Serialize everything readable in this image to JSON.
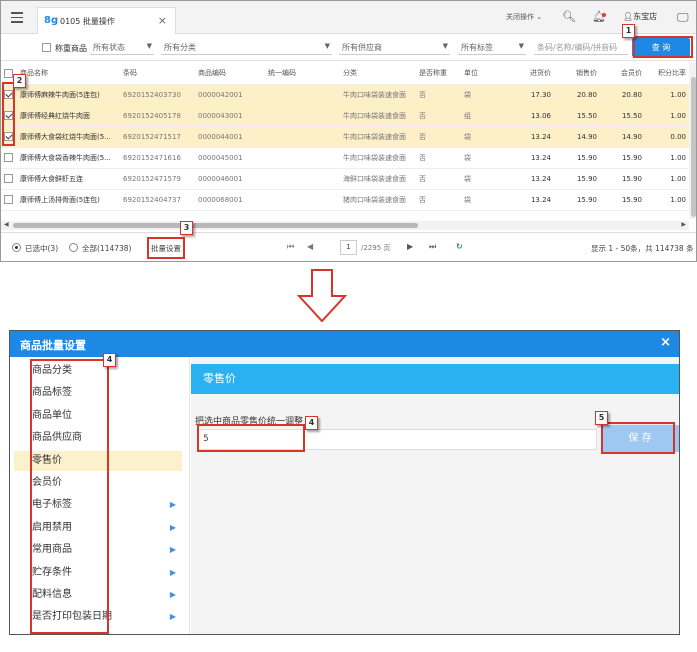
{
  "app": {
    "tab_icon": "8g",
    "tab_title": "0105 批量操作",
    "tab_close": "×",
    "close_ops": "关闭操作",
    "store_name": "东宝店"
  },
  "filters": {
    "weighted_label": "称重商品",
    "status": "所有状态",
    "category": "所有分类",
    "supplier": "所有供应商",
    "tag": "所有标签",
    "search_placeholder": "条码/名称/编码/拼音码",
    "query_button": "查 询"
  },
  "table": {
    "columns": [
      "商品名称",
      "条码",
      "商品编码",
      "统一编码",
      "分类",
      "是否称重",
      "单位",
      "进货价",
      "销售价",
      "会员价",
      "积分比率"
    ],
    "rows": [
      {
        "selected": true,
        "cells": [
          "康师傅麻辣牛肉面(5连包)",
          "6920152403730",
          "0000042001",
          "",
          "牛肉口味袋装速食面",
          "否",
          "袋",
          "17.30",
          "20.80",
          "20.80",
          "1.00"
        ]
      },
      {
        "selected": true,
        "cells": [
          "康师傅经典红烧牛肉面",
          "6920152405178",
          "0000043001",
          "",
          "牛肉口味袋装速食面",
          "否",
          "组",
          "13.06",
          "15.50",
          "15.50",
          "1.00"
        ]
      },
      {
        "selected": true,
        "cells": [
          "康师傅大食袋红烧牛肉面(5...",
          "6920152471517",
          "0000044001",
          "",
          "牛肉口味袋装速食面",
          "否",
          "袋",
          "13.24",
          "14.90",
          "14.90",
          "0.00"
        ]
      },
      {
        "selected": false,
        "cells": [
          "康师傅大食袋香辣牛肉面(5...",
          "6920152471616",
          "0000045001",
          "",
          "牛肉口味袋装速食面",
          "否",
          "袋",
          "13.24",
          "15.90",
          "15.90",
          "1.00"
        ]
      },
      {
        "selected": false,
        "cells": [
          "康师傅大食鲜虾五连",
          "6920152471579",
          "0000046001",
          "",
          "海鲜口味袋装速食面",
          "否",
          "袋",
          "13.24",
          "15.90",
          "15.90",
          "1.00"
        ]
      },
      {
        "selected": false,
        "cells": [
          "康师傅上汤排骨面(5连包)",
          "6920152404737",
          "0000068001",
          "",
          "猪肉口味袋装速食面",
          "否",
          "袋",
          "13.24",
          "15.90",
          "15.90",
          "1.00"
        ]
      }
    ]
  },
  "footer": {
    "selected_label": "已选中(3)",
    "all_label": "全部(114738)",
    "batch_button": "批量设置",
    "page_value": "1",
    "page_total": "/2295 页",
    "summary": "显示 1 - 50条，共 114738 条"
  },
  "annotations": [
    "1",
    "2",
    "3",
    "4",
    "4",
    "5"
  ],
  "dialog": {
    "title": "商品批量设置",
    "close": "×",
    "menu": [
      {
        "label": "商品分类",
        "has_sub": false,
        "active": false
      },
      {
        "label": "商品标签",
        "has_sub": false,
        "active": false
      },
      {
        "label": "商品单位",
        "has_sub": false,
        "active": false
      },
      {
        "label": "商品供应商",
        "has_sub": false,
        "active": false
      },
      {
        "label": "零售价",
        "has_sub": false,
        "active": true
      },
      {
        "label": "会员价",
        "has_sub": false,
        "active": false
      },
      {
        "label": "电子标签",
        "has_sub": true,
        "active": false
      },
      {
        "label": "启用禁用",
        "has_sub": true,
        "active": false
      },
      {
        "label": "常用商品",
        "has_sub": true,
        "active": false
      },
      {
        "label": "贮存条件",
        "has_sub": true,
        "active": false
      },
      {
        "label": "配料信息",
        "has_sub": true,
        "active": false
      },
      {
        "label": "是否打印包装日期",
        "has_sub": true,
        "active": false
      }
    ],
    "section_title": "零售价",
    "field_label": "把选中商品零售价统一调整",
    "field_value": "5",
    "save_button": "保 存"
  }
}
